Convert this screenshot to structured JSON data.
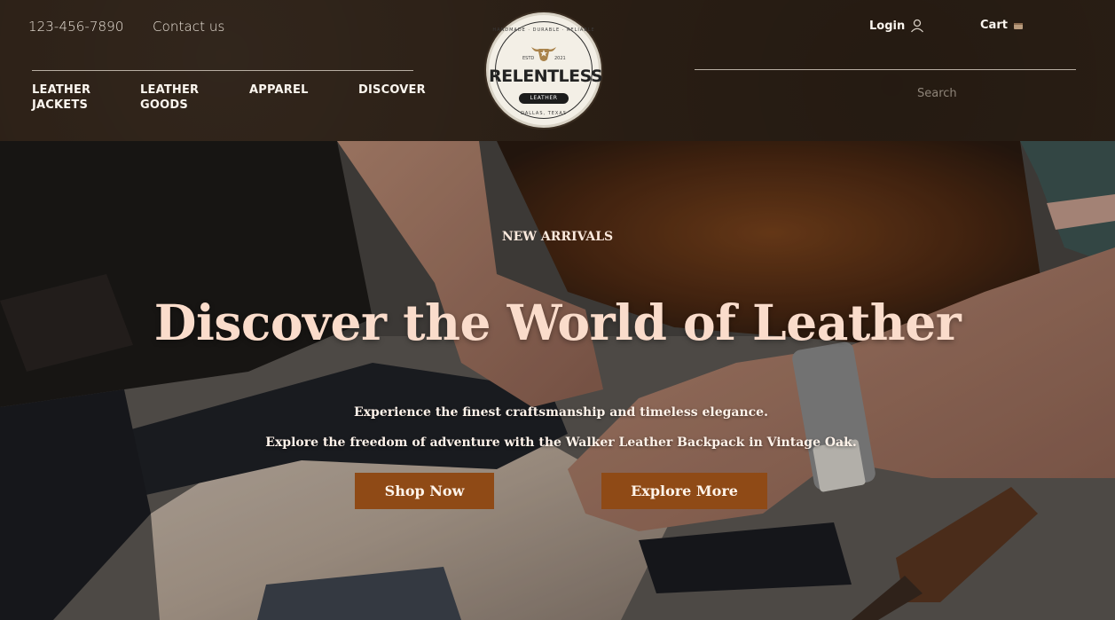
{
  "header": {
    "phone": "123-456-7890",
    "contact": "Contact us",
    "nav": [
      {
        "label": "LEATHER\nJACKETS"
      },
      {
        "label": "LEATHER\nGOODS"
      },
      {
        "label": "APPAREL"
      },
      {
        "label": "DISCOVER"
      }
    ],
    "login": "Login",
    "cart": "Cart",
    "search_placeholder": "Search"
  },
  "logo": {
    "top_arc": "HANDMADE · DURABLE · RELIABLE",
    "est": "ESTD",
    "year": "2021",
    "name": "RELENTLESS",
    "badge": "LEATHER",
    "bottom_arc": "DALLAS, TEXAS"
  },
  "hero": {
    "eyebrow": "NEW ARRIVALS",
    "headline": "Discover the World of Leather",
    "sub1": "Experience the finest craftsmanship and timeless elegance.",
    "sub2": "Explore the freedom of adventure with the Walker Leather Backpack in Vintage Oak.",
    "shop_button": "Shop Now",
    "explore_button": "Explore More"
  },
  "colors": {
    "header_bg": "#2b1f15",
    "button_bg": "#8f4a16",
    "headline": "#fadccb"
  },
  "icons": {
    "login": "user-icon",
    "cart": "cart-icon",
    "logo": "bull-head-icon"
  }
}
